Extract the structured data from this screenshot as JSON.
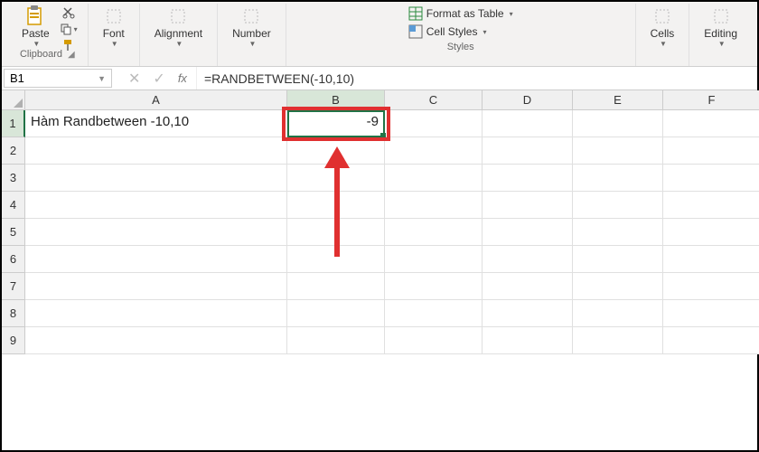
{
  "ribbon": {
    "clipboard": {
      "paste": "Paste",
      "label": "Clipboard"
    },
    "font": {
      "btn": "Font",
      "label": ""
    },
    "alignment": {
      "btn": "Alignment",
      "label": ""
    },
    "number": {
      "btn": "Number",
      "label": ""
    },
    "styles": {
      "format_table": "Format as Table",
      "cell_styles": "Cell Styles",
      "label": "Styles"
    },
    "cells": {
      "btn": "Cells",
      "label": ""
    },
    "editing": {
      "btn": "Editing",
      "label": ""
    }
  },
  "formula_bar": {
    "name_box": "B1",
    "fx": "fx",
    "formula": "=RANDBETWEEN(-10,10)"
  },
  "columns": [
    "A",
    "B",
    "C",
    "D",
    "E",
    "F"
  ],
  "rows": [
    "1",
    "2",
    "3",
    "4",
    "5",
    "6",
    "7",
    "8",
    "9"
  ],
  "cells": {
    "A1": "Hàm Randbetween -10,10",
    "B1": "-9"
  },
  "active_cell": "B1"
}
